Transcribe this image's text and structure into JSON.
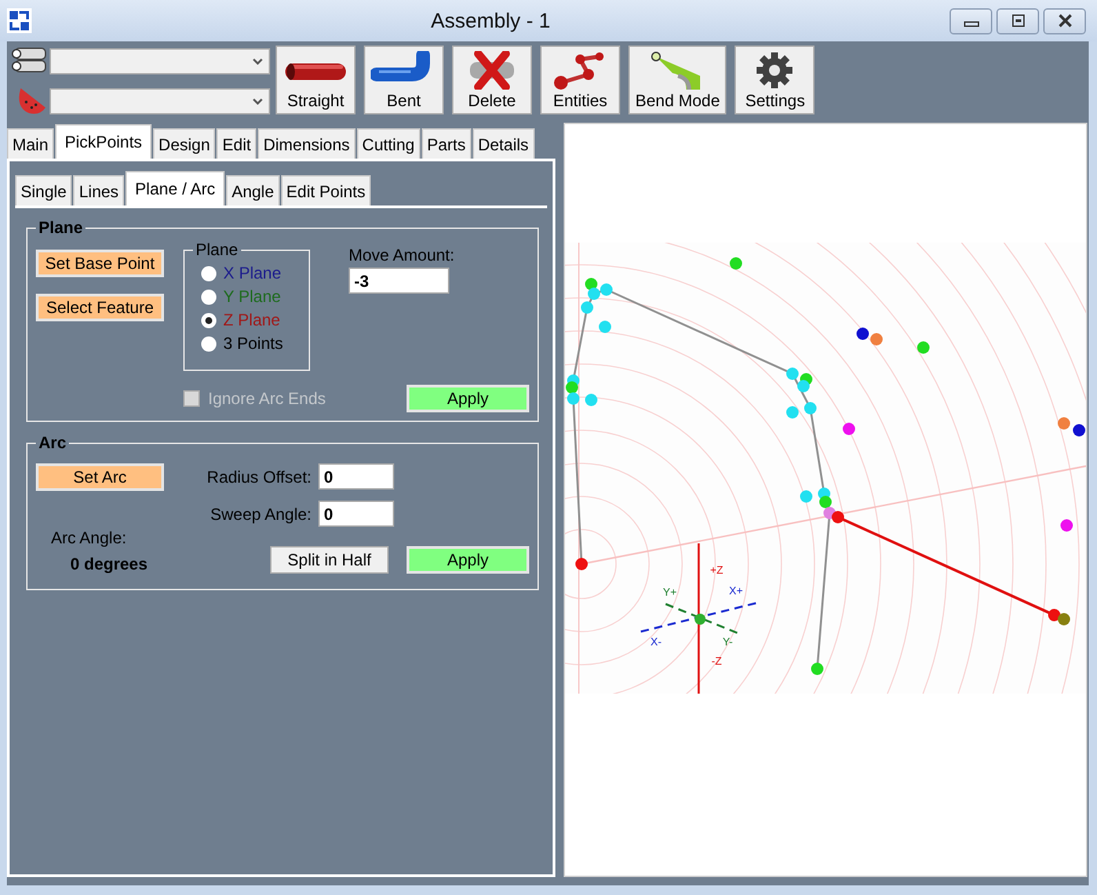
{
  "window": {
    "title": "Assembly - 1"
  },
  "toolbar": {
    "buttons": [
      {
        "label": "Straight",
        "kind": "straight"
      },
      {
        "label": "Bent",
        "kind": "bent"
      },
      {
        "label": "Delete",
        "kind": "delete"
      },
      {
        "label": "Entities",
        "kind": "entities"
      },
      {
        "label": "Bend Mode",
        "kind": "bend"
      },
      {
        "label": "Settings",
        "kind": "settings"
      }
    ]
  },
  "tabs": [
    {
      "label": "Main",
      "selected": false
    },
    {
      "label": "PickPoints",
      "selected": true
    },
    {
      "label": "Design",
      "selected": false
    },
    {
      "label": "Edit",
      "selected": false
    },
    {
      "label": "Dimensions",
      "selected": false
    },
    {
      "label": "Cutting",
      "selected": false
    },
    {
      "label": "Parts",
      "selected": false
    },
    {
      "label": "Details",
      "selected": false
    }
  ],
  "subtabs": [
    {
      "label": "Single",
      "selected": false
    },
    {
      "label": "Lines",
      "selected": false
    },
    {
      "label": "Plane / Arc",
      "selected": true
    },
    {
      "label": "Angle",
      "selected": false
    },
    {
      "label": "Edit Points",
      "selected": false
    }
  ],
  "plane_group": {
    "title": "Plane",
    "buttons": [
      "Set Base Point",
      "Select Feature"
    ],
    "plane_box": {
      "title": "Plane",
      "options": [
        {
          "label": "X Plane",
          "selected": false,
          "color": "#1c1c8c"
        },
        {
          "label": "Y Plane",
          "selected": false,
          "color": "#1e6b1e"
        },
        {
          "label": "Z Plane",
          "selected": true,
          "color": "#a01818"
        },
        {
          "label": "3 Points",
          "selected": false,
          "color": "#000000"
        }
      ]
    },
    "move_amount": {
      "label": "Move Amount:",
      "value": "-3"
    },
    "ignore_arc_ends": {
      "label": "Ignore Arc Ends",
      "checked": false,
      "disabled": true
    },
    "apply": "Apply"
  },
  "arc_group": {
    "title": "Arc",
    "set_arc": "Set Arc",
    "radius_offset": {
      "label": "Radius Offset:",
      "value": "0"
    },
    "sweep_angle": {
      "label": "Sweep Angle:",
      "value": "0"
    },
    "arc_angle_label": "Arc Angle:",
    "arc_angle_value": "0 degrees",
    "split": "Split in Half",
    "apply": "Apply"
  },
  "viewport": {
    "axis_labels": [
      "+Z",
      "-Z",
      "X+",
      "X-",
      "Y+",
      "Y-"
    ]
  }
}
